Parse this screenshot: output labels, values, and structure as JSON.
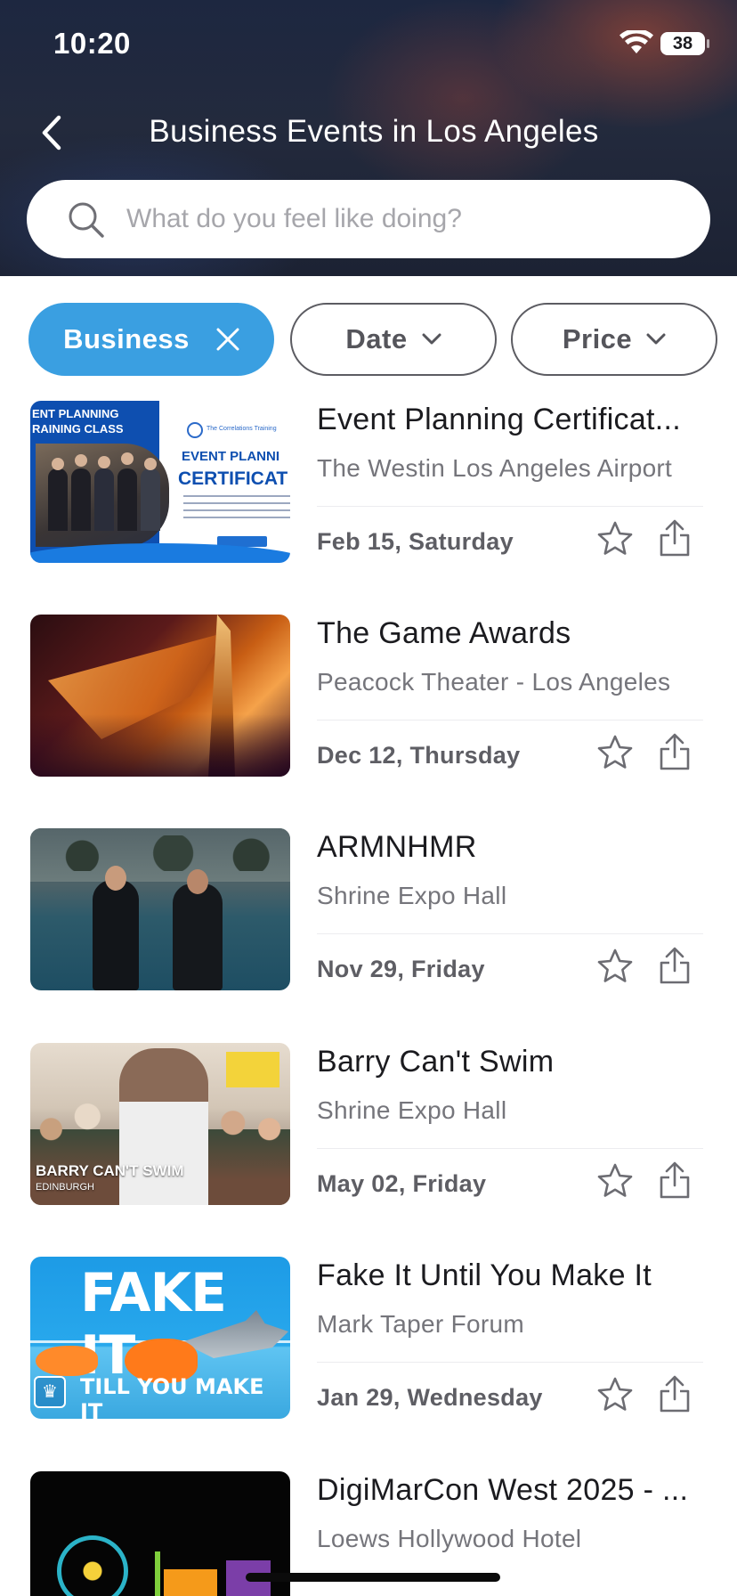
{
  "status_bar": {
    "time": "10:20",
    "battery": "38"
  },
  "header": {
    "title": "Business Events in Los Angeles"
  },
  "search": {
    "placeholder": "What do you feel like doing?",
    "value": ""
  },
  "filters": [
    {
      "label": "Business",
      "active": true
    },
    {
      "label": "Date",
      "active": false
    },
    {
      "label": "Price",
      "active": false
    }
  ],
  "events": [
    {
      "title": "Event Planning Certificat...",
      "venue": "The Westin Los Angeles Airport",
      "date": "Feb 15, Saturday",
      "thumb_text": {
        "tag_line1": "ENT PLANNING",
        "tag_line2": "RAINING CLASS",
        "org": "The Correlations Training",
        "heading1": "EVENT PLANNI",
        "heading2": "CERTIFICAT"
      }
    },
    {
      "title": "The Game Awards",
      "venue": "Peacock Theater - Los Angeles",
      "date": "Dec 12, Thursday"
    },
    {
      "title": "ARMNHMR",
      "venue": "Shrine Expo Hall",
      "date": "Nov 29, Friday"
    },
    {
      "title": "Barry Can't Swim",
      "venue": "Shrine Expo Hall",
      "date": "May 02, Friday",
      "thumb_text": {
        "caption": "BARRY CAN'T SWIM",
        "subcaption": "EDINBURGH"
      }
    },
    {
      "title": "Fake It Until You Make It",
      "venue": "Mark Taper Forum",
      "date": "Jan 29, Wednesday",
      "thumb_text": {
        "big": "FAKE IT",
        "sub": "TILL YOU MAKE IT"
      }
    },
    {
      "title": "DigiMarCon West 2025 - ...",
      "venue": "Loews Hollywood Hotel",
      "date": ""
    }
  ],
  "colors": {
    "accent": "#3a9fe1",
    "text_primary": "#1b1b1f",
    "text_secondary": "#75757b"
  }
}
